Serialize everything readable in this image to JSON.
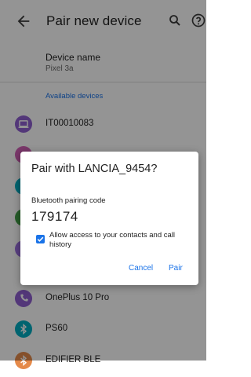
{
  "app_bar": {
    "title": "Pair new device",
    "back_icon": "arrow-back-icon",
    "search_icon": "search-icon",
    "help_icon": "help-icon"
  },
  "device_name": {
    "label": "Device name",
    "value": "Pixel 3a"
  },
  "available_devices": {
    "header": "Available devices",
    "items": [
      {
        "label": "IT00010083",
        "icon": "laptop-icon",
        "color": "#8f5fd1"
      },
      {
        "label": "",
        "icon": "phone-icon",
        "color": "#d35fb7"
      },
      {
        "label": "",
        "icon": "bluetooth-icon",
        "color": "#00acc1"
      },
      {
        "label": "",
        "icon": "bluetooth-icon",
        "color": "#43a047"
      },
      {
        "label": "",
        "icon": "bluetooth-icon",
        "color": "#9c6fe0"
      },
      {
        "label": "OnePlus 10 Pro",
        "icon": "phone-icon",
        "color": "#8f5fd1"
      },
      {
        "label": "PS60",
        "icon": "bluetooth-icon",
        "color": "#00acc1"
      },
      {
        "label": "EDIFIER BLE",
        "icon": "bluetooth-icon",
        "color": "#e58a4a"
      }
    ]
  },
  "dialog": {
    "title": "Pair with LANCIA_9454?",
    "code_label": "Bluetooth pairing code",
    "code": "179174",
    "checkbox_label": "Allow access to your contacts and call history",
    "checkbox_checked": true,
    "cancel_label": "Cancel",
    "pair_label": "Pair"
  },
  "colors": {
    "accent": "#1a73e8",
    "text": "#1f1f1f"
  }
}
